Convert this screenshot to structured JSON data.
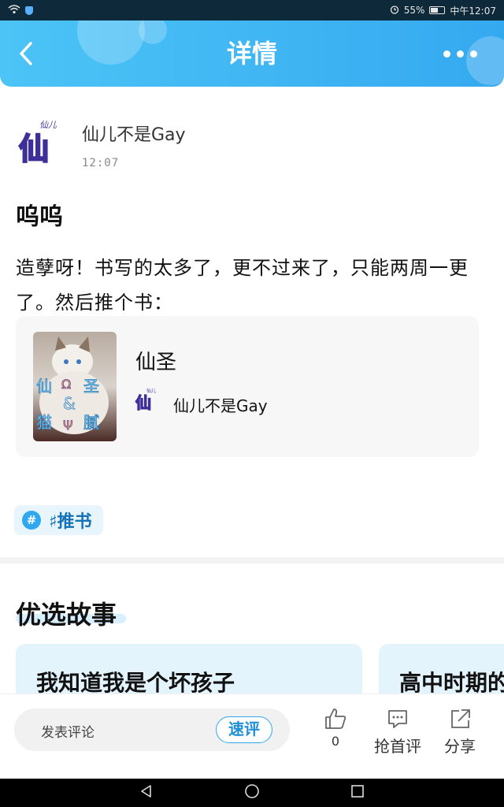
{
  "status_bar": {
    "battery": "55%",
    "time": "中午12:07"
  },
  "header": {
    "title": "详情"
  },
  "author": {
    "name": "仙儿不是Gay",
    "time": "12:07",
    "avatar_glyph": "仙"
  },
  "post": {
    "title": "呜呜",
    "body": "造孽呀！书写的太多了，更不过来了，只能两周一更了。然后推个书："
  },
  "book": {
    "title": "仙圣",
    "author": "仙儿不是Gay",
    "cover_text": {
      "top_left": "仙",
      "top_mid": "Ω",
      "top_right": "圣",
      "middle": "&",
      "bottom_left": "猫",
      "bottom_mid": "Ψ",
      "bottom_right": "腻"
    }
  },
  "tag": {
    "icon": "#",
    "label": "♯推书"
  },
  "section": {
    "title": "优选故事"
  },
  "stories": [
    {
      "title": "我知道我是个坏孩子"
    },
    {
      "title": "高中时期的"
    }
  ],
  "action_bar": {
    "comment_placeholder": "发表评论",
    "quick_comment": "速评",
    "like_count": "0",
    "first_comment": "抢首评",
    "share": "分享"
  },
  "colors": {
    "accent": "#35a9f0",
    "tag_text": "#1572b6",
    "status_bar": "#0e2a3a"
  }
}
